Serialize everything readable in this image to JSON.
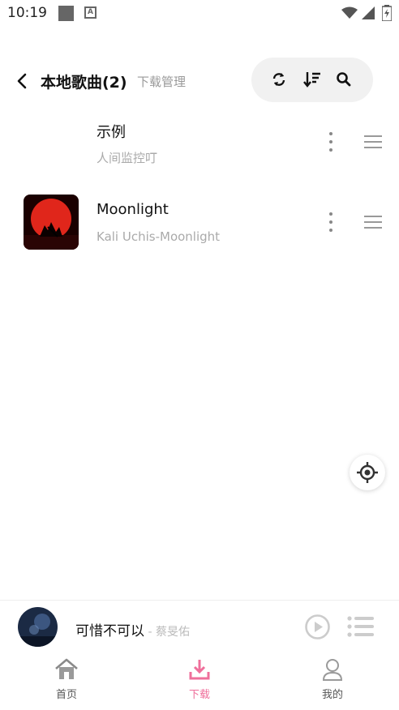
{
  "status_bar": {
    "time": "10:19",
    "icons": [
      "notification-square-icon",
      "a-icon",
      "wifi-icon",
      "signal-icon",
      "battery-icon"
    ]
  },
  "header": {
    "title": "本地歌曲(2)",
    "subtitle": "下载管理",
    "actions": [
      "refresh-icon",
      "sort-icon",
      "search-icon"
    ]
  },
  "songs": [
    {
      "title": "示例",
      "subtitle": "人间监控叮",
      "has_cover": false
    },
    {
      "title": "Moonlight",
      "subtitle": "Kali Uchis-Moonlight",
      "has_cover": true
    }
  ],
  "mini_player": {
    "title": "可惜不可以",
    "artist": " - 蔡旻佑"
  },
  "bottom_nav": {
    "items": [
      {
        "label": "首页",
        "icon": "home-icon",
        "active": false
      },
      {
        "label": "下载",
        "icon": "download-icon",
        "active": true
      },
      {
        "label": "我的",
        "icon": "user-icon",
        "active": false
      }
    ]
  },
  "colors": {
    "accent": "#ef6f9b",
    "inactive": "#8a8a8a",
    "pill_bg": "#f1f1f1"
  }
}
